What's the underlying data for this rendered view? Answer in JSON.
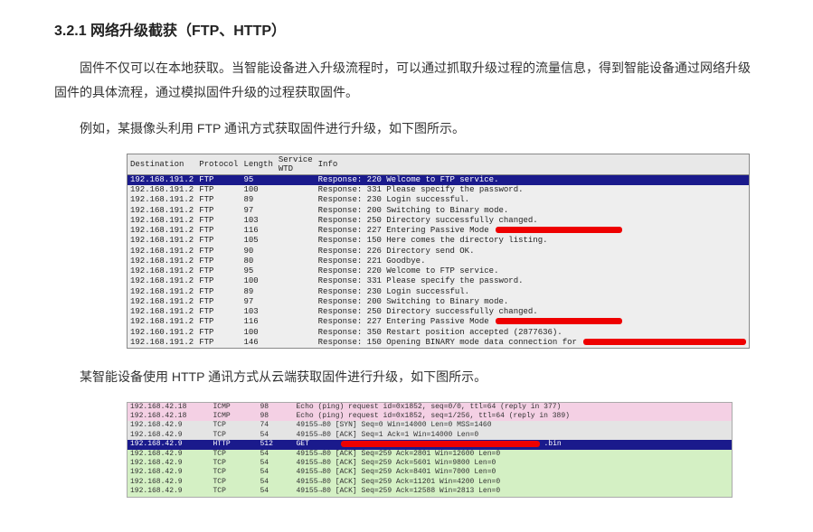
{
  "heading": "3.2.1  网络升级截获（FTP、HTTP）",
  "para1": "固件不仅可以在本地获取。当智能设备进入升级流程时，可以通过抓取升级过程的流量信息，得到智能设备通过网络升级固件的具体流程，通过模拟固件升级的过程获取固件。",
  "para2": "例如，某摄像头利用 FTP 通讯方式获取固件进行升级，如下图所示。",
  "para3": "某智能设备使用 HTTP 通讯方式从云端获取固件进行升级，如下图所示。",
  "chart_data": [
    {
      "type": "table",
      "title": "FTP capture",
      "columns": [
        "Destination",
        "Protocol",
        "Length",
        "Service WTD",
        "Info"
      ],
      "rows": [
        {
          "dest": "192.168.191.2",
          "proto": "FTP",
          "len": "95",
          "svc": "",
          "info": "Response: 220 Welcome to FTP service.",
          "hl": true,
          "redact": ""
        },
        {
          "dest": "192.168.191.2",
          "proto": "FTP",
          "len": "100",
          "svc": "",
          "info": "Response: 331 Please specify the password.",
          "hl": false,
          "redact": ""
        },
        {
          "dest": "192.168.191.2",
          "proto": "FTP",
          "len": "89",
          "svc": "",
          "info": "Response: 230 Login successful.",
          "hl": false,
          "redact": ""
        },
        {
          "dest": "192.168.191.2",
          "proto": "FTP",
          "len": "97",
          "svc": "",
          "info": "Response: 200 Switching to Binary mode.",
          "hl": false,
          "redact": ""
        },
        {
          "dest": "192.168.191.2",
          "proto": "FTP",
          "len": "103",
          "svc": "",
          "info": "Response: 250 Directory successfully changed.",
          "hl": false,
          "redact": ""
        },
        {
          "dest": "192.168.191.2",
          "proto": "FTP",
          "len": "116",
          "svc": "",
          "info": "Response: 227 Entering Passive Mode ",
          "hl": false,
          "redact": "med"
        },
        {
          "dest": "192.168.191.2",
          "proto": "FTP",
          "len": "105",
          "svc": "",
          "info": "Response: 150 Here comes the directory listing.",
          "hl": false,
          "redact": ""
        },
        {
          "dest": "192.168.191.2",
          "proto": "FTP",
          "len": "90",
          "svc": "",
          "info": "Response: 226 Directory send OK.",
          "hl": false,
          "redact": ""
        },
        {
          "dest": "192.168.191.2",
          "proto": "FTP",
          "len": "80",
          "svc": "",
          "info": "Response: 221 Goodbye.",
          "hl": false,
          "redact": ""
        },
        {
          "dest": "192.168.191.2",
          "proto": "FTP",
          "len": "95",
          "svc": "",
          "info": "Response: 220 Welcome to FTP service.",
          "hl": false,
          "redact": ""
        },
        {
          "dest": "192.168.191.2",
          "proto": "FTP",
          "len": "100",
          "svc": "",
          "info": "Response: 331 Please specify the password.",
          "hl": false,
          "redact": ""
        },
        {
          "dest": "192.168.191.2",
          "proto": "FTP",
          "len": "89",
          "svc": "",
          "info": "Response: 230 Login successful.",
          "hl": false,
          "redact": ""
        },
        {
          "dest": "192.168.191.2",
          "proto": "FTP",
          "len": "97",
          "svc": "",
          "info": "Response: 200 Switching to Binary mode.",
          "hl": false,
          "redact": ""
        },
        {
          "dest": "192.168.191.2",
          "proto": "FTP",
          "len": "103",
          "svc": "",
          "info": "Response: 250 Directory successfully changed.",
          "hl": false,
          "redact": ""
        },
        {
          "dest": "192.168.191.2",
          "proto": "FTP",
          "len": "116",
          "svc": "",
          "info": "Response: 227 Entering Passive Mode ",
          "hl": false,
          "redact": "med"
        },
        {
          "dest": "192.160.191.2",
          "proto": "FTP",
          "len": "100",
          "svc": "",
          "info": "Response: 350 Restart position accepted (2877636).",
          "hl": false,
          "redact": ""
        },
        {
          "dest": "192.168.191.2",
          "proto": "FTP",
          "len": "146",
          "svc": "",
          "info": "Response: 150 Opening BINARY mode data connection for ",
          "hl": false,
          "redact": "lg"
        }
      ]
    },
    {
      "type": "table",
      "title": "HTTP capture",
      "columns": [
        "Destination",
        "Protocol",
        "Length",
        "Info"
      ],
      "rows": [
        {
          "dest": "192.168.42.18",
          "proto": "ICMP",
          "len": "98",
          "info": "Echo (ping) request  id=0x1852, seq=0/0, ttl=64 (reply in 377)",
          "cls": "row-pink",
          "redact": ""
        },
        {
          "dest": "192.168.42.18",
          "proto": "ICMP",
          "len": "98",
          "info": "Echo (ping) request  id=0x1852, seq=1/256, ttl=64 (reply in 389)",
          "cls": "row-pink",
          "redact": ""
        },
        {
          "dest": "192.168.42.9",
          "proto": "TCP",
          "len": "74",
          "info": "49155→80 [SYN] Seq=0 Win=14000 Len=0 MSS=1460",
          "cls": "row-grey",
          "redact": ""
        },
        {
          "dest": "192.168.42.9",
          "proto": "TCP",
          "len": "54",
          "info": "49155→80 [ACK] Seq=1 Ack=1 Win=14000 Len=0",
          "cls": "row-grey",
          "redact": ""
        },
        {
          "dest": "192.168.42.9",
          "proto": "HTTP",
          "len": "512",
          "info": "GET ",
          "cls": "row-dark",
          "redact": "lg"
        },
        {
          "dest": "192.168.42.9",
          "proto": "TCP",
          "len": "54",
          "info": "49155→80 [ACK] Seq=259 Ack=2801 Win=12600 Len=0",
          "cls": "row-green",
          "redact": ""
        },
        {
          "dest": "192.168.42.9",
          "proto": "TCP",
          "len": "54",
          "info": "49155→80 [ACK] Seq=259 Ack=5601 Win=9800 Len=0",
          "cls": "row-green",
          "redact": ""
        },
        {
          "dest": "192.168.42.9",
          "proto": "TCP",
          "len": "54",
          "info": "49155→80 [ACK] Seq=259 Ack=8401 Win=7000 Len=0",
          "cls": "row-green",
          "redact": ""
        },
        {
          "dest": "192.168.42.9",
          "proto": "TCP",
          "len": "54",
          "info": "49155→80 [ACK] Seq=259 Ack=11201 Win=4200 Len=0",
          "cls": "row-green",
          "redact": ""
        },
        {
          "dest": "192.168.42.9",
          "proto": "TCP",
          "len": "54",
          "info": "49155→80 [ACK] Seq=259 Ack=12588 Win=2813 Len=0",
          "cls": "row-green",
          "redact": ""
        }
      ]
    }
  ]
}
